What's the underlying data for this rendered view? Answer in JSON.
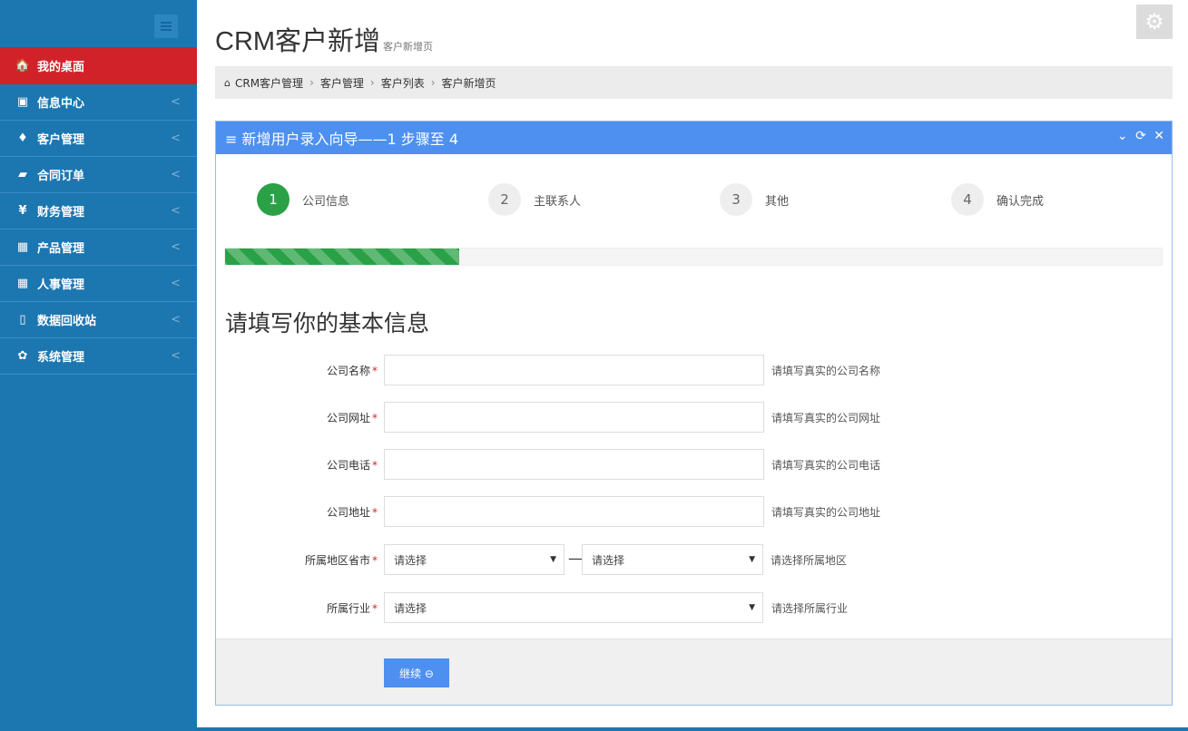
{
  "sidebar": {
    "items": [
      {
        "label": "我的桌面",
        "icon": "home-icon",
        "glyph": "🏠",
        "active": true
      },
      {
        "label": "信息中心",
        "icon": "monitor-icon",
        "glyph": "▣"
      },
      {
        "label": "客户管理",
        "icon": "user-icon",
        "glyph": "♦"
      },
      {
        "label": "合同订单",
        "icon": "book-icon",
        "glyph": "▰"
      },
      {
        "label": "财务管理",
        "icon": "yen-icon",
        "glyph": "¥"
      },
      {
        "label": "产品管理",
        "icon": "table-icon",
        "glyph": "▦"
      },
      {
        "label": "人事管理",
        "icon": "table-icon",
        "glyph": "▦"
      },
      {
        "label": "数据回收站",
        "icon": "trash-icon",
        "glyph": "▯"
      },
      {
        "label": "系统管理",
        "icon": "gear-icon",
        "glyph": "✿"
      }
    ],
    "arrow": "<"
  },
  "header": {
    "title": "CRM客户新增",
    "subtitle": "客户新增页",
    "settings_glyph": "⚙"
  },
  "breadcrumb": {
    "home_glyph": "⌂",
    "items": [
      "CRM客户管理",
      "客户管理",
      "客户列表",
      "客户新增页"
    ],
    "separator": "›"
  },
  "panel": {
    "title": "≡ 新增用户录入向导——1 步骤至 4",
    "tools": [
      "⌄",
      "⟳",
      "✕"
    ]
  },
  "steps": [
    {
      "num": "1",
      "label": "公司信息",
      "done": true
    },
    {
      "num": "2",
      "label": "主联系人",
      "done": false
    },
    {
      "num": "3",
      "label": "其他",
      "done": false
    },
    {
      "num": "4",
      "label": "确认完成",
      "done": false
    }
  ],
  "progress": {
    "percent": 25
  },
  "form": {
    "section_title": "请填写你的基本信息",
    "required_mark": "*",
    "fields": [
      {
        "label": "公司名称",
        "help": "请填写真实的公司名称",
        "value": ""
      },
      {
        "label": "公司网址",
        "help": "请填写真实的公司网址",
        "value": ""
      },
      {
        "label": "公司电话",
        "help": "请填写真实的公司电话",
        "value": ""
      },
      {
        "label": "公司地址",
        "help": "请填写真实的公司地址",
        "value": ""
      }
    ],
    "region": {
      "label": "所属地区省市",
      "province": "请选择",
      "city": "请选择",
      "dash": "—",
      "help": "请选择所属地区"
    },
    "industry": {
      "label": "所属行业",
      "value": "请选择",
      "help": "请选择所属行业"
    },
    "caret": "▼",
    "continue_label": "继续 ⊖"
  },
  "colors": {
    "sidebar": "#1c76b0",
    "active": "#d22229",
    "panel_head": "#4d90f0",
    "progress": "#2aa146"
  }
}
